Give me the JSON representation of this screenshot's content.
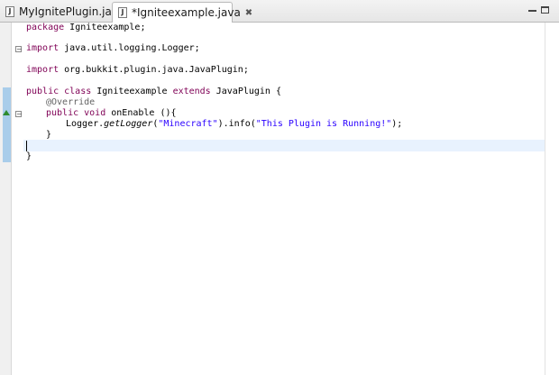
{
  "tabs": [
    {
      "label": "MyIgnitePlugin.java",
      "active": false,
      "icon": "java-file-icon"
    },
    {
      "label": "*Igniteexample.java",
      "active": true,
      "icon": "java-file-icon",
      "close": "✖"
    }
  ],
  "window_controls": {
    "minimize": "minimize-icon",
    "maximize": "maximize-icon"
  },
  "code": {
    "l1": {
      "kw": "package",
      "rest": " Igniteexample;"
    },
    "l3": {
      "kw": "import",
      "rest": " java.util.logging.Logger;"
    },
    "l5": {
      "kw": "import",
      "rest": " org.bukkit.plugin.java.JavaPlugin;"
    },
    "l7": {
      "kw1": "public class",
      "mid": " Igniteexample ",
      "kw2": "extends",
      "rest": " JavaPlugin {"
    },
    "l8": {
      "ann": "@Override"
    },
    "l9": {
      "kw": "public void",
      "rest": " onEnable (){"
    },
    "l10": {
      "a": "Logger.",
      "method": "getLogger",
      "b": "(",
      "s1": "\"Minecraft\"",
      "c": ").info(",
      "s2": "\"This Plugin is Running!\"",
      "d": ");"
    },
    "l11": {
      "text": "}"
    },
    "l13": {
      "text": "}"
    }
  },
  "colors": {
    "keyword": "#7f0055",
    "annotation": "#646464",
    "string": "#2a00ff",
    "current_line": "#e8f2fe",
    "quick_diff": "#a9cdea"
  }
}
